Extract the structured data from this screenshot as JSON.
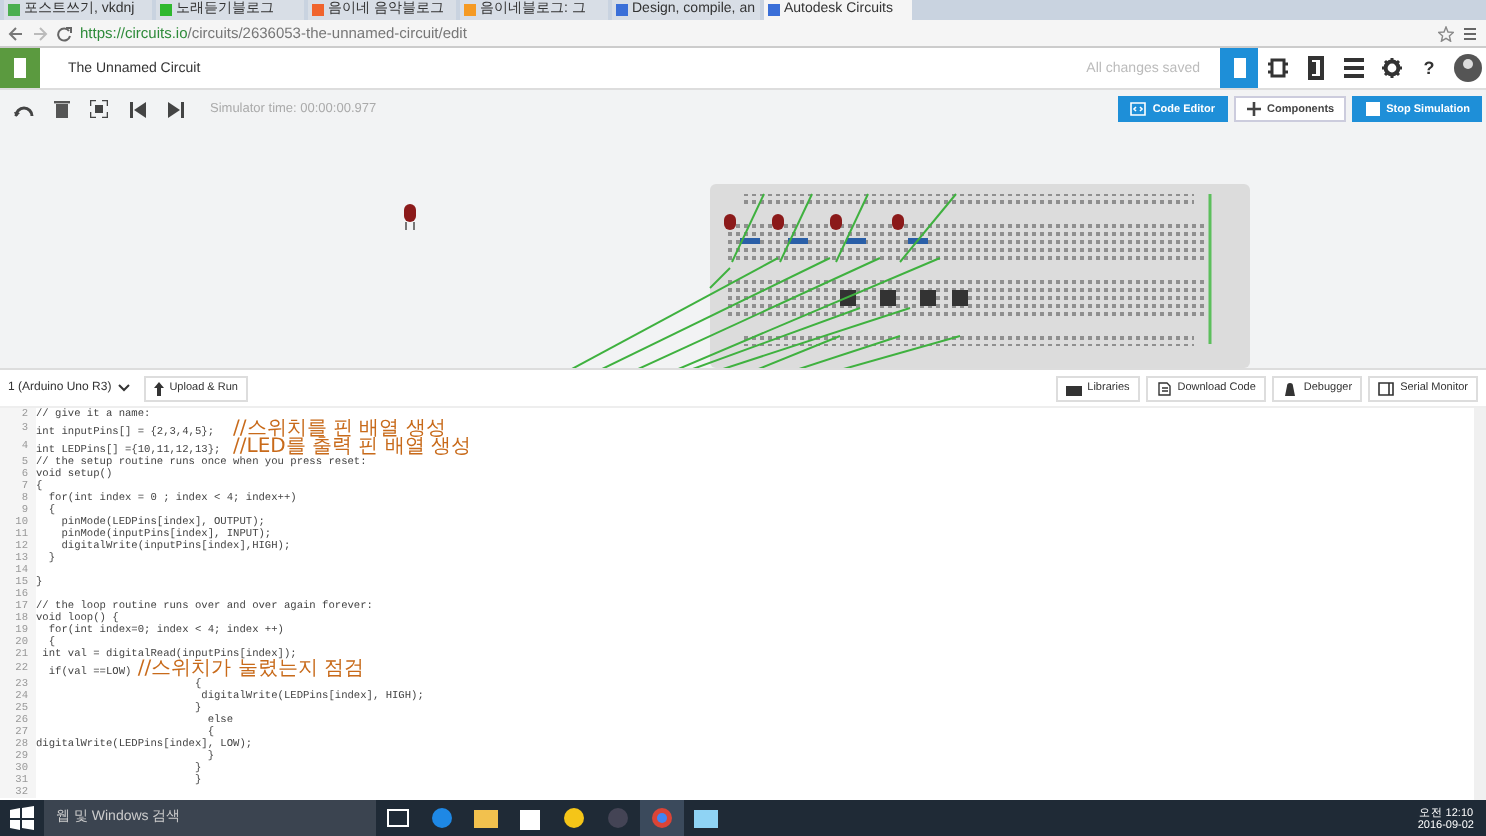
{
  "browser": {
    "tabs": [
      {
        "title": "포스트쓰기, vkdnj",
        "selected": false,
        "color": "#4caf50"
      },
      {
        "title": "노래듣기블로그",
        "selected": false,
        "color": "#2eb82e"
      },
      {
        "title": "음이네 음악블로그",
        "selected": false,
        "color": "#f0642d"
      },
      {
        "title": "음이네블로그: 그",
        "selected": false,
        "color": "#f59a23"
      },
      {
        "title": "Design, compile, an",
        "selected": false,
        "color": "#3a6fd8"
      },
      {
        "title": "Autodesk Circuits",
        "selected": true,
        "color": "#3a6fd8"
      }
    ],
    "url_host": "https://circuits.io",
    "url_path": "/circuits/2636053-the-unnamed-circuit/edit"
  },
  "app": {
    "title": "The Unnamed Circuit",
    "save_status": "All changes saved",
    "help": "?",
    "view_tabs": [
      {
        "kind": "breadboard",
        "selected": true
      },
      {
        "kind": "schematic",
        "selected": false
      },
      {
        "kind": "pcb",
        "selected": false
      },
      {
        "kind": "list",
        "selected": false
      }
    ]
  },
  "toolbar": {
    "simulator_time": "Simulator time: 00:00:00.977",
    "buttons": [
      {
        "label": "Code Editor",
        "kind": "code"
      },
      {
        "label": "Components",
        "kind": "add"
      },
      {
        "label": "Stop Simulation",
        "kind": "stop"
      }
    ]
  },
  "code_editor": {
    "board": "1 (Arduino Uno R3)",
    "upload": "Upload & Run",
    "tools": [
      {
        "label": "Libraries",
        "kind": "libraries"
      },
      {
        "label": "Download Code",
        "kind": "download"
      },
      {
        "label": "Debugger",
        "kind": "debugger"
      },
      {
        "label": "Serial Monitor",
        "kind": "monitor"
      }
    ],
    "lines": [
      {
        "number": "2",
        "code": "// give it a name:"
      },
      {
        "number": "3",
        "code": "int inputPins[] = {2,3,4,5};   ",
        "comment": "//스위치를 핀 배열 생성"
      },
      {
        "number": "4",
        "code": "int LEDPins[] ={10,11,12,13};  ",
        "comment": "//LED를 출력 핀 배열 생성"
      },
      {
        "number": "5",
        "code": "// the setup routine runs once when you press reset:"
      },
      {
        "number": "6",
        "code": "void setup()"
      },
      {
        "number": "7",
        "code": "{"
      },
      {
        "number": "8",
        "code": "  for(int index = 0 ; index < 4; index++)"
      },
      {
        "number": "9",
        "code": "  {"
      },
      {
        "number": "10",
        "code": "    pinMode(LEDPins[index], OUTPUT);"
      },
      {
        "number": "11",
        "code": "    pinMode(inputPins[index], INPUT);"
      },
      {
        "number": "12",
        "code": "    digitalWrite(inputPins[index],HIGH);"
      },
      {
        "number": "13",
        "code": "  }"
      },
      {
        "number": "14"
      },
      {
        "number": "15",
        "code": "}"
      },
      {
        "number": "16"
      },
      {
        "number": "17",
        "code": "// the loop routine runs over and over again forever:"
      },
      {
        "number": "18",
        "code": "void loop() {"
      },
      {
        "number": "19",
        "code": "  for(int index=0; index < 4; index ++)"
      },
      {
        "number": "20",
        "code": "  {"
      },
      {
        "number": "21",
        "code": " int val = digitalRead(inputPins[index]);"
      },
      {
        "number": "22",
        "code": "  if(val ==LOW) ",
        "comment": "//스위치가 눌렸는지 점검"
      },
      {
        "number": "23",
        "code": "                         {"
      },
      {
        "number": "24",
        "code": "                          digitalWrite(LEDPins[index], HIGH);"
      },
      {
        "number": "25",
        "code": "                         }"
      },
      {
        "number": "26",
        "code": "                           else"
      },
      {
        "number": "27",
        "code": "                           {"
      },
      {
        "number": "28",
        "code": "digitalWrite(LEDPins[index], LOW);"
      },
      {
        "number": "29",
        "code": "                           }"
      },
      {
        "number": "30",
        "code": "                         }"
      },
      {
        "number": "31",
        "code": "                         }"
      },
      {
        "number": "32"
      }
    ]
  },
  "taskbar": {
    "search_placeholder": "웹 및 Windows 검색",
    "time": "오전 12:10",
    "date": "2016-09-02"
  }
}
